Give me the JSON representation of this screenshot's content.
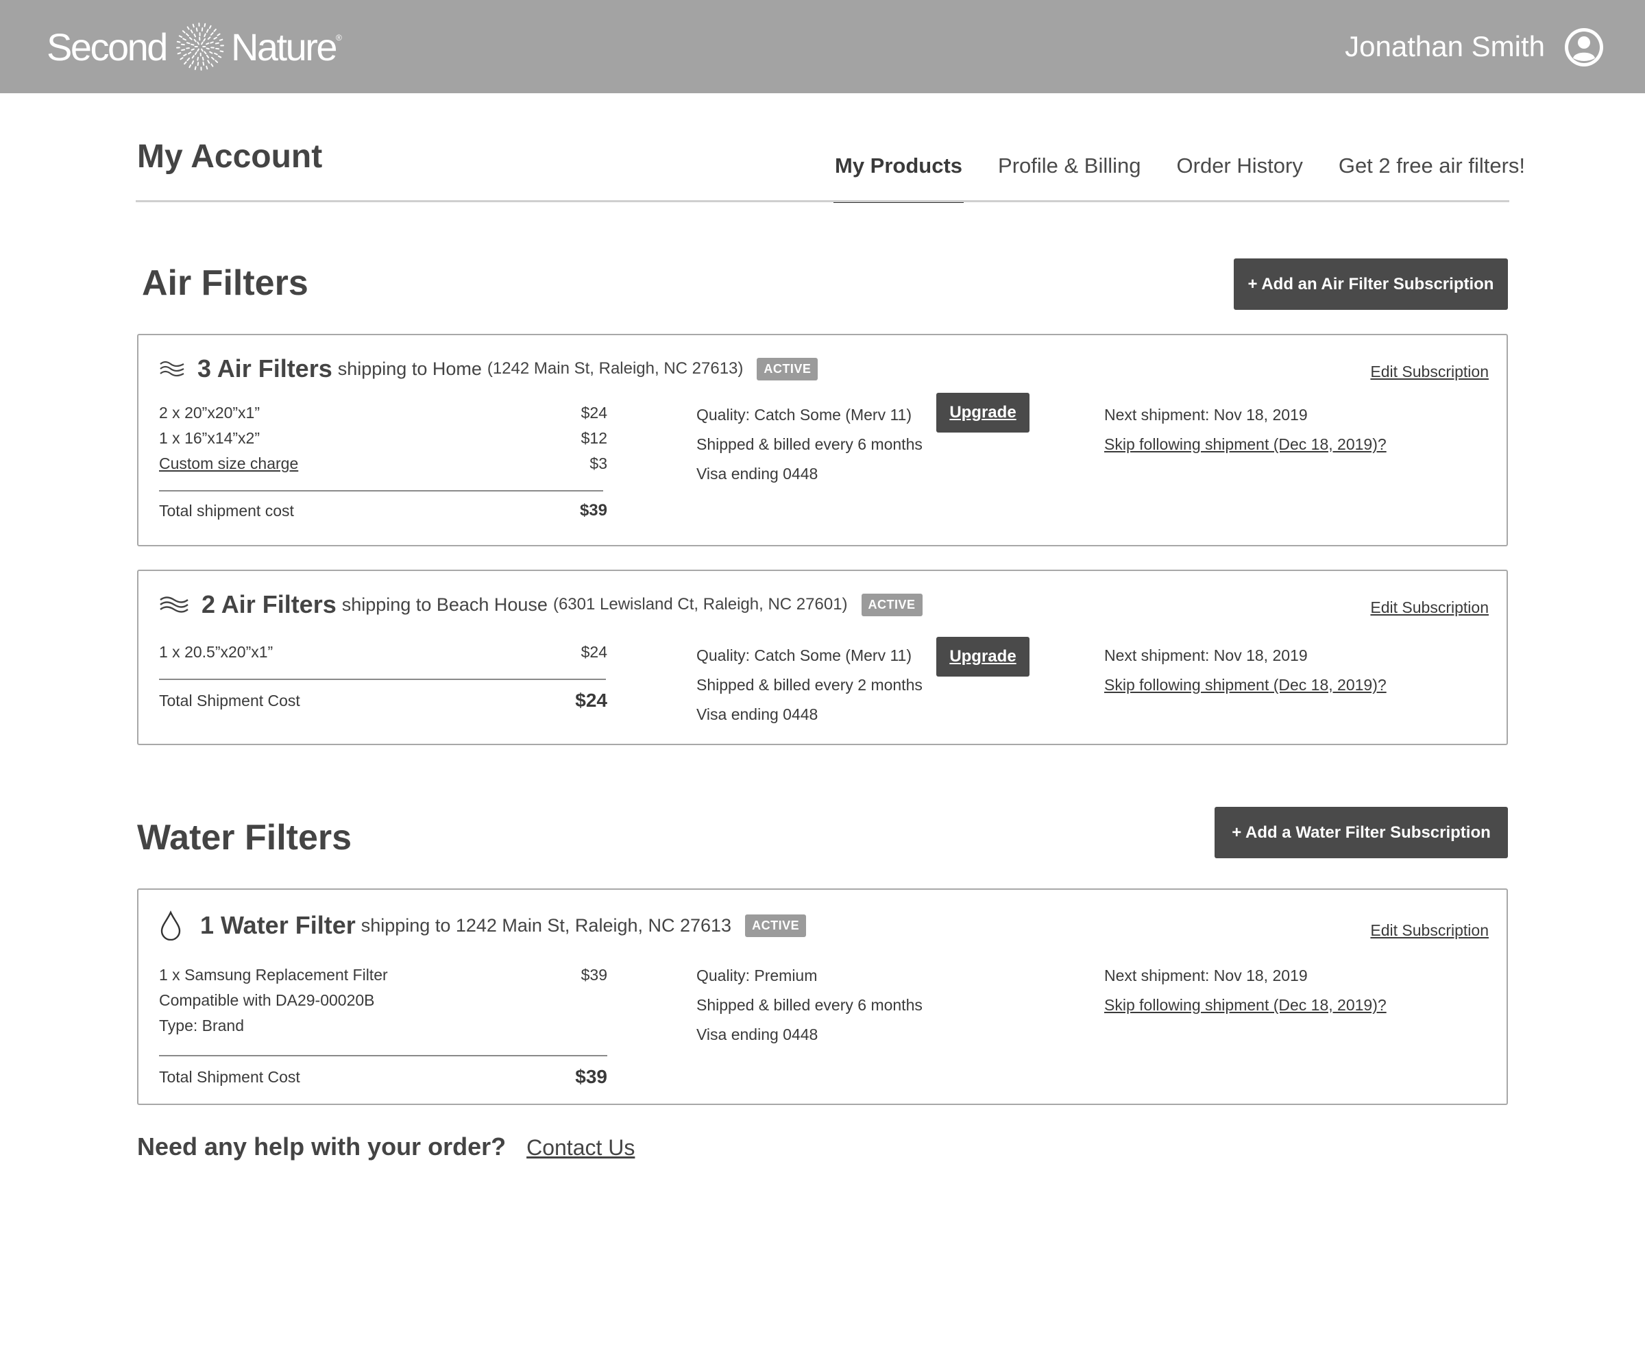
{
  "header": {
    "brand_left": "Second",
    "brand_right": "Nature",
    "user_name": "Jonathan Smith",
    "avatar_icon": "user-avatar-icon"
  },
  "account": {
    "title": "My Account",
    "tabs": [
      {
        "label": "My Products",
        "active": true
      },
      {
        "label": "Profile & Billing",
        "active": false
      },
      {
        "label": "Order History",
        "active": false
      },
      {
        "label": "Get 2 free air filters!",
        "active": false
      }
    ]
  },
  "air": {
    "title": "Air Filters",
    "add_label": "+ Add an Air Filter Subscription",
    "subs": [
      {
        "qty_title": "3 Air Filters",
        "ship_to": "shipping to Home",
        "address": "(1242 Main St, Raleigh, NC 27613)",
        "status": "ACTIVE",
        "edit": "Edit Subscription",
        "items": [
          {
            "desc": "2  x  20”x20”x1”",
            "price": "$24"
          },
          {
            "desc": "1  x  16”x14”x2”",
            "price": "$12"
          },
          {
            "desc": "Custom size charge",
            "price": "$3"
          }
        ],
        "total_label": "Total shipment cost",
        "total": "$39",
        "quality": "Quality:  Catch Some (Merv 11)",
        "frequency": "Shipped & billed every 6 months",
        "payment": "Visa ending 0448",
        "upgrade": "Upgrade",
        "next": "Next shipment: Nov 18, 2019",
        "skip": "Skip following shipment (Dec 18, 2019)?"
      },
      {
        "qty_title": "2 Air Filters",
        "ship_to": "shipping to Beach House",
        "address": "(6301 Lewisland Ct, Raleigh, NC 27601)",
        "status": "ACTIVE",
        "edit": "Edit Subscription",
        "items": [
          {
            "desc": "1  x  20.5”x20”x1”",
            "price": "$24"
          }
        ],
        "total_label": "Total Shipment Cost",
        "total": "$24",
        "quality": "Quality: Catch Some (Merv 11)",
        "frequency": "Shipped & billed every 2 months",
        "payment": "Visa ending 0448",
        "upgrade": "Upgrade",
        "next": "Next shipment: Nov 18, 2019",
        "skip": "Skip following shipment (Dec 18, 2019)?"
      }
    ]
  },
  "water": {
    "title": "Water Filters",
    "add_label": "+ Add a Water Filter Subscription",
    "subs": [
      {
        "qty_title": "1 Water Filter",
        "ship_to": "shipping to 1242 Main St, Raleigh, NC 27613",
        "status": "ACTIVE",
        "edit": "Edit Subscription",
        "items": [
          {
            "desc": "1 x Samsung Replacement Filter",
            "price": "$39"
          },
          {
            "desc": "Compatible with DA29-00020B",
            "price": ""
          },
          {
            "desc": "Type: Brand",
            "price": ""
          }
        ],
        "total_label": "Total Shipment Cost",
        "total": "$39",
        "quality": "Quality: Premium",
        "frequency": "Shipped & billed every 6 months",
        "payment": "Visa ending 0448",
        "next": "Next shipment: Nov 18, 2019",
        "skip": "Skip following shipment (Dec 18, 2019)?"
      }
    ]
  },
  "help": {
    "question": "Need any help with your order?",
    "contact": "Contact Us"
  },
  "icons": {
    "air": "air-waves-icon",
    "water": "water-drop-icon",
    "logo": "sunburst-logo-icon"
  }
}
